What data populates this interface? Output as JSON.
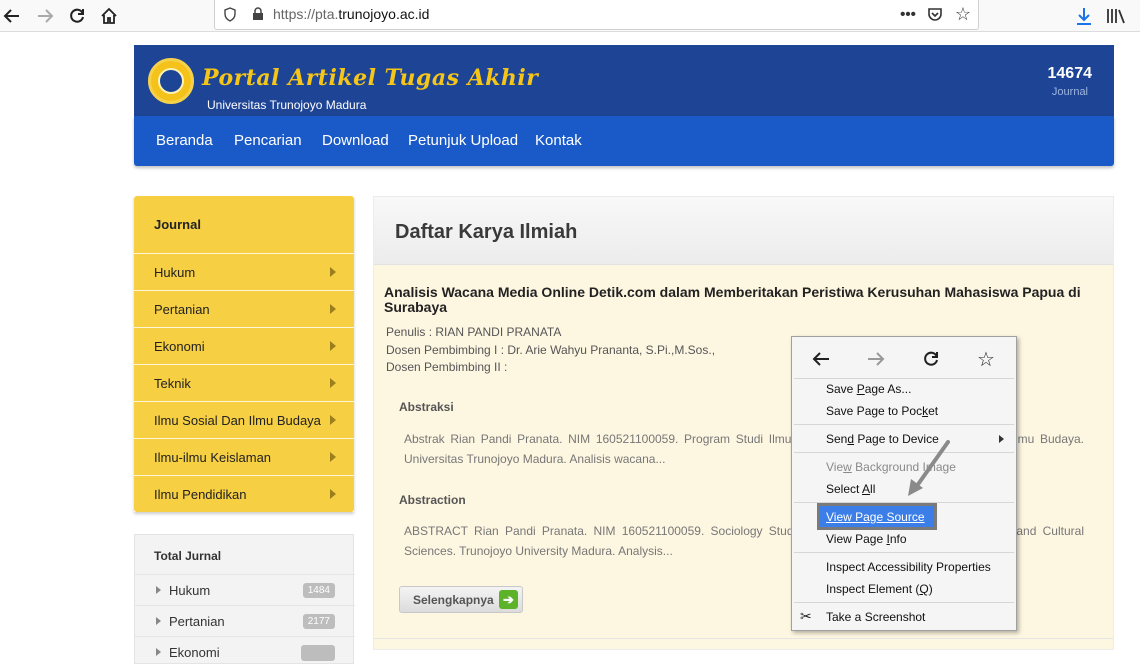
{
  "browser": {
    "url_prefix": "https://pta.",
    "url_domain": "trunojoyo.ac.id",
    "icons": {
      "back": "arrow-left-icon",
      "forward": "arrow-right-icon",
      "reload": "reload-icon",
      "home": "home-icon",
      "shield": "shield-icon",
      "lock": "lock-icon",
      "more": "more-icon",
      "pocket": "pocket-icon",
      "bookmark": "star-icon",
      "downloads": "download-icon",
      "library": "library-icon"
    }
  },
  "header": {
    "title": "Portal Artikel Tugas Akhir",
    "subtitle": "Universitas Trunojoyo Madura",
    "journal_count": "14674",
    "journal_label": "Journal"
  },
  "nav": {
    "items": [
      "Beranda",
      "Pencarian",
      "Download",
      "Petunjuk Upload",
      "Kontak"
    ]
  },
  "sidebar": {
    "heading": "Journal",
    "items": [
      "Hukum",
      "Pertanian",
      "Ekonomi",
      "Teknik",
      "Ilmu Sosial Dan Ilmu Budaya",
      "Ilmu-ilmu Keislaman",
      "Ilmu Pendidikan"
    ]
  },
  "totals": {
    "heading": "Total Jurnal",
    "rows": [
      {
        "name": "Hukum",
        "count": "1484"
      },
      {
        "name": "Pertanian",
        "count": "2177"
      },
      {
        "name": "Ekonomi",
        "count": ""
      }
    ]
  },
  "content": {
    "page_title": "Daftar Karya Ilmiah",
    "article_title": "Analisis Wacana Media Online Detik.com dalam Memberitakan Peristiwa Kerusuhan Mahasiswa Papua di Surabaya",
    "penulis": "Penulis : RIAN PANDI PRANATA",
    "pembimbing1": "Dosen Pembimbing I : Dr. Arie Wahyu Prananta, S.Pi.,M.Sos.,",
    "pembimbing2": "Dosen Pembimbing II :",
    "abstraksi_label": "Abstraksi",
    "abstraksi_text": "Abstrak Rian Pandi Pranata. NIM 160521100059. Program Studi Ilmu Komunikasi, Fakultas Ilmu Sosial dan Ilmu Budaya. Universitas Trunojoyo Madura. Analisis wacana...",
    "abstraction_label": "Abstraction",
    "abstraction_text": "ABSTRACT Rian Pandi Pranata. NIM 160521100059. Sociology Study Program, Faculty of Social Sciences and Cultural Sciences. Trunojoyo University Madura. Analysis...",
    "more_label": "Selengkapnya"
  },
  "context_menu": {
    "items": {
      "save_as_pre": "Save ",
      "save_as_u": "P",
      "save_as_post": "age As...",
      "pocket_pre": "Save Page to Poc",
      "pocket_u": "k",
      "pocket_post": "et",
      "send_pre": "Sen",
      "send_u": "d",
      "send_post": " Page to Device",
      "bg_pre": "Vie",
      "bg_u": "w",
      "bg_post": " Background Image",
      "select_pre": "Select ",
      "select_u": "A",
      "select_post": "ll",
      "view_source": "View Page Source",
      "info_pre": "View Page ",
      "info_u": "I",
      "info_post": "nfo",
      "accessibility": "Inspect Accessibility Properties",
      "inspect_pre": "Inspect Element (",
      "inspect_u": "Q",
      "inspect_post": ")",
      "screenshot": "Take a Screenshot"
    }
  }
}
